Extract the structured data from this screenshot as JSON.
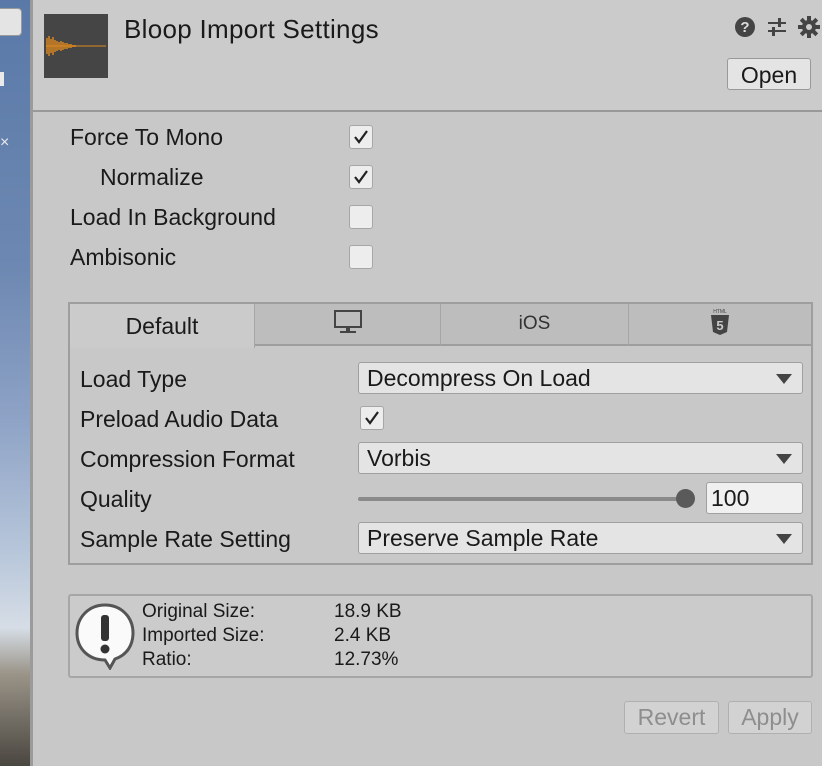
{
  "header": {
    "title": "Bloop Import Settings",
    "open_label": "Open",
    "icons": [
      "help-icon",
      "preset-sliders-icon",
      "gear-icon"
    ]
  },
  "flags": {
    "force_to_mono": {
      "label": "Force To Mono",
      "checked": true
    },
    "normalize": {
      "label": "Normalize",
      "checked": true
    },
    "load_in_background": {
      "label": "Load In Background",
      "checked": false
    },
    "ambisonic": {
      "label": "Ambisonic",
      "checked": false
    }
  },
  "tabs": [
    {
      "label": "Default",
      "icon": "",
      "active": true
    },
    {
      "label": "",
      "icon": "monitor-icon",
      "active": false
    },
    {
      "label": "iOS",
      "icon": "",
      "active": false
    },
    {
      "label": "",
      "icon": "html5-icon",
      "active": false
    }
  ],
  "settings": {
    "load_type": {
      "label": "Load Type",
      "value": "Decompress On Load"
    },
    "preload_audio_data": {
      "label": "Preload Audio Data",
      "checked": true
    },
    "compression_format": {
      "label": "Compression Format",
      "value": "Vorbis"
    },
    "quality": {
      "label": "Quality",
      "value": "100",
      "slider_fraction": 1.0
    },
    "sample_rate_setting": {
      "label": "Sample Rate Setting",
      "value": "Preserve Sample Rate"
    }
  },
  "info": {
    "original_size_label": "Original Size:",
    "original_size_value": "18.9 KB",
    "imported_size_label": "Imported Size:",
    "imported_size_value": "2.4 KB",
    "ratio_label": "Ratio:",
    "ratio_value": "12.73%"
  },
  "footer": {
    "revert_label": "Revert",
    "apply_label": "Apply"
  },
  "colors": {
    "inspector_bg": "#c8c8c8",
    "waveform": "#e08a1e"
  }
}
